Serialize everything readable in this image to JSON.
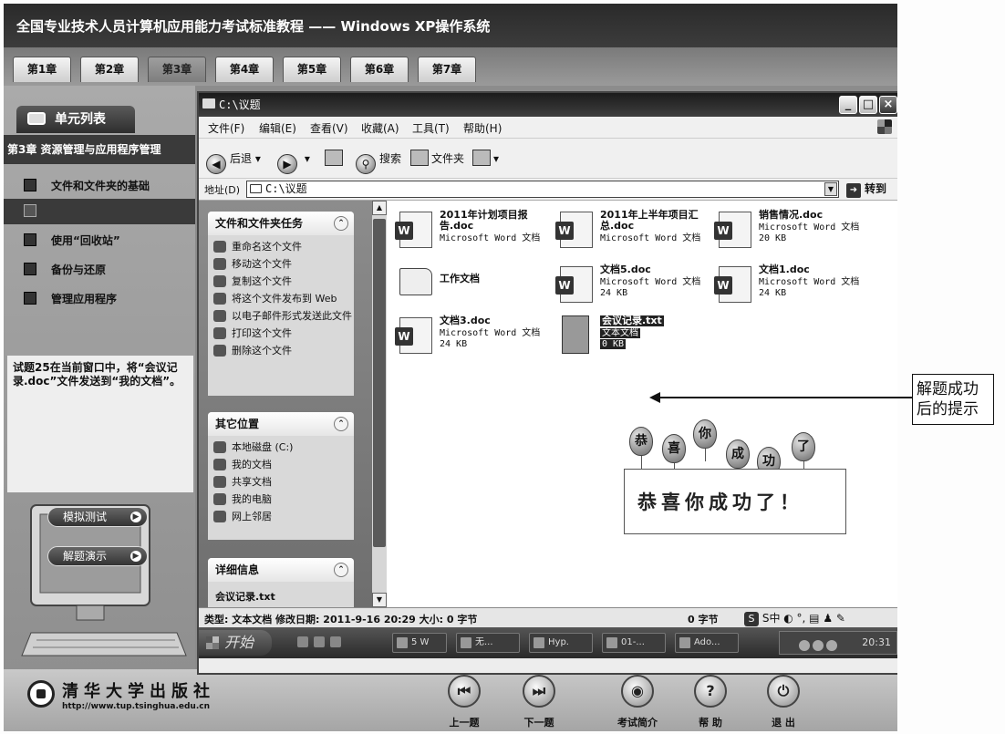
{
  "app": {
    "title": "全国专业技术人员计算机应用能力考试标准教程 —— Windows XP操作系统",
    "chapter_tabs": [
      "第1章",
      "第2章",
      "第3章",
      "第4章",
      "第5章",
      "第6章",
      "第7章"
    ],
    "active_chapter": "第3章"
  },
  "left_panel": {
    "unit_list_label": "单元列表",
    "chapter_header": "第3章 资源管理与应用程序管理",
    "units": [
      {
        "label": "文件和文件夹的基础",
        "selected": false
      },
      {
        "label": "",
        "selected": true
      },
      {
        "label": "使用“回收站”",
        "selected": false
      },
      {
        "label": "备份与还原",
        "selected": false
      },
      {
        "label": "管理应用程序",
        "selected": false
      }
    ],
    "task_text": "试题25在当前窗口中，将“会议记录.doc”文件发送到“我的文档”。",
    "sim_test_button": "模拟测试",
    "demo_button": "解题演示"
  },
  "footer": {
    "publisher_name": "清华大学出版社",
    "publisher_url": "http://www.tup.tsinghua.edu.cn",
    "nav_buttons": [
      {
        "label": "上一题",
        "icon": "previous-icon",
        "glyph": "⏮"
      },
      {
        "label": "下一题",
        "icon": "next-icon",
        "glyph": "⏭"
      },
      {
        "label": "考试简介",
        "icon": "eye-icon",
        "glyph": "◉"
      },
      {
        "label": "帮 助",
        "icon": "help-icon",
        "glyph": "?"
      },
      {
        "label": "退 出",
        "icon": "exit-icon",
        "glyph": "⏻"
      }
    ]
  },
  "explorer": {
    "title": "C:\\议题",
    "window_buttons": {
      "minimize": "_",
      "maximize": "□",
      "close": "×"
    },
    "menus": [
      "文件(F)",
      "编辑(E)",
      "查看(V)",
      "收藏(A)",
      "工具(T)",
      "帮助(H)"
    ],
    "toolbar": {
      "back": "后退",
      "search": "搜索",
      "folders": "文件夹"
    },
    "address": {
      "label": "地址(D)",
      "value": "C:\\议题",
      "go": "转到"
    },
    "task_groups": {
      "file_tasks": {
        "title": "文件和文件夹任务",
        "links": [
          "重命名这个文件",
          "移动这个文件",
          "复制这个文件",
          "将这个文件发布到 Web",
          "以电子邮件形式发送此文件",
          "打印这个文件",
          "删除这个文件"
        ]
      },
      "other_places": {
        "title": "其它位置",
        "links": [
          "本地磁盘 (C:)",
          "我的文档",
          "共享文档",
          "我的电脑",
          "网上邻居"
        ]
      },
      "details": {
        "title": "详细信息",
        "file_name": "会议记录.txt"
      }
    },
    "files": [
      {
        "name": "2011年计划项目报告.doc",
        "type": "Microsoft Word 文档",
        "size": "",
        "kind": "word"
      },
      {
        "name": "2011年上半年项目汇总.doc",
        "type": "Microsoft Word 文档",
        "size": "",
        "kind": "word"
      },
      {
        "name": "销售情况.doc",
        "type": "Microsoft Word 文档",
        "size": "20 KB",
        "kind": "word"
      },
      {
        "name": "工作文档",
        "type": "",
        "size": "",
        "kind": "folder"
      },
      {
        "name": "文档5.doc",
        "type": "Microsoft Word 文档",
        "size": "24 KB",
        "kind": "word"
      },
      {
        "name": "文档1.doc",
        "type": "Microsoft Word 文档",
        "size": "24 KB",
        "kind": "word"
      },
      {
        "name": "文档3.doc",
        "type": "Microsoft Word 文档",
        "size": "24 KB",
        "kind": "word"
      },
      {
        "name": "会议记录.txt",
        "type": "文本文档",
        "size": "0 KB",
        "kind": "text",
        "selected": true
      }
    ],
    "success_message": "恭喜你成功了！",
    "balloons": [
      "恭",
      "喜",
      "你",
      "成",
      "功",
      "了"
    ],
    "status": {
      "text": "类型: 文本文档 修改日期: 2011-9-16 20:29 大小: 0 字节",
      "size": "0 字节",
      "ime": "S中"
    },
    "taskbar": {
      "start": "开始",
      "items": [
        "5 W",
        "无...",
        "Hyp.",
        "01-...",
        "Ado..."
      ],
      "clock": "20:31"
    }
  },
  "annotation": {
    "text": "解题成功后的提示"
  }
}
